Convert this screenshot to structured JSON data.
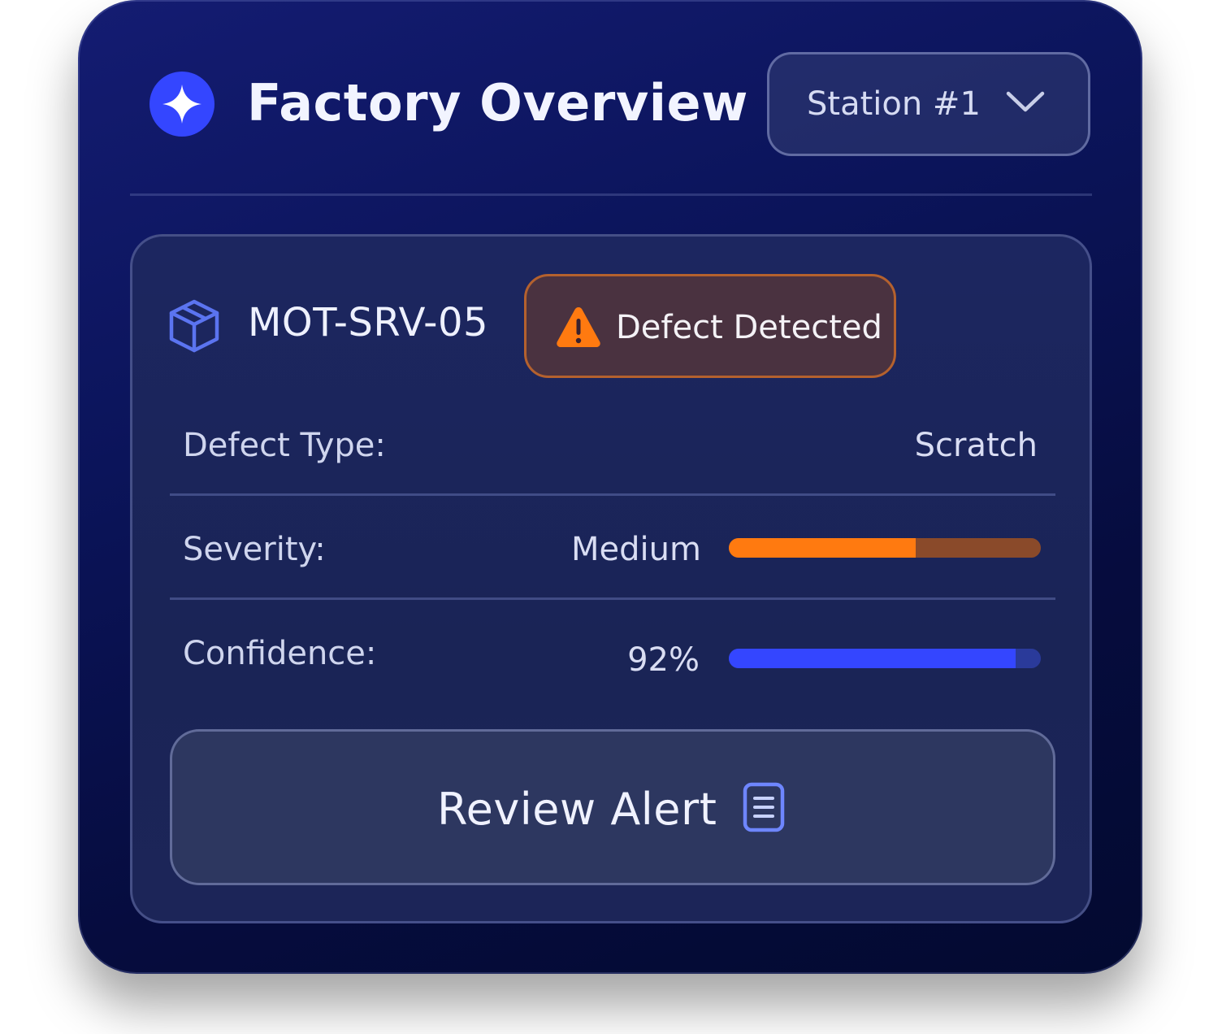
{
  "header": {
    "title": "Factory Overview",
    "icon": "sparkle-icon",
    "accent_color": "#3446ff"
  },
  "station_select": {
    "selected": "Station #1",
    "icon": "chevron-down-icon"
  },
  "part": {
    "id": "MOT-SRV-05",
    "icon": "cube-icon",
    "status_badge": {
      "label": "Defect Detected",
      "icon": "warning-icon",
      "color": "#ff7a10"
    }
  },
  "details": {
    "defect_type": {
      "label": "Defect Type:",
      "value": "Scratch"
    },
    "severity": {
      "label": "Severity:",
      "value": "Medium",
      "level": 0.6,
      "color": "#ff7a10"
    },
    "confidence": {
      "label": "Confidence:",
      "value": "92%",
      "level": 0.92,
      "color": "#3446ff"
    }
  },
  "action": {
    "label": "Review Alert",
    "icon": "document-icon"
  }
}
